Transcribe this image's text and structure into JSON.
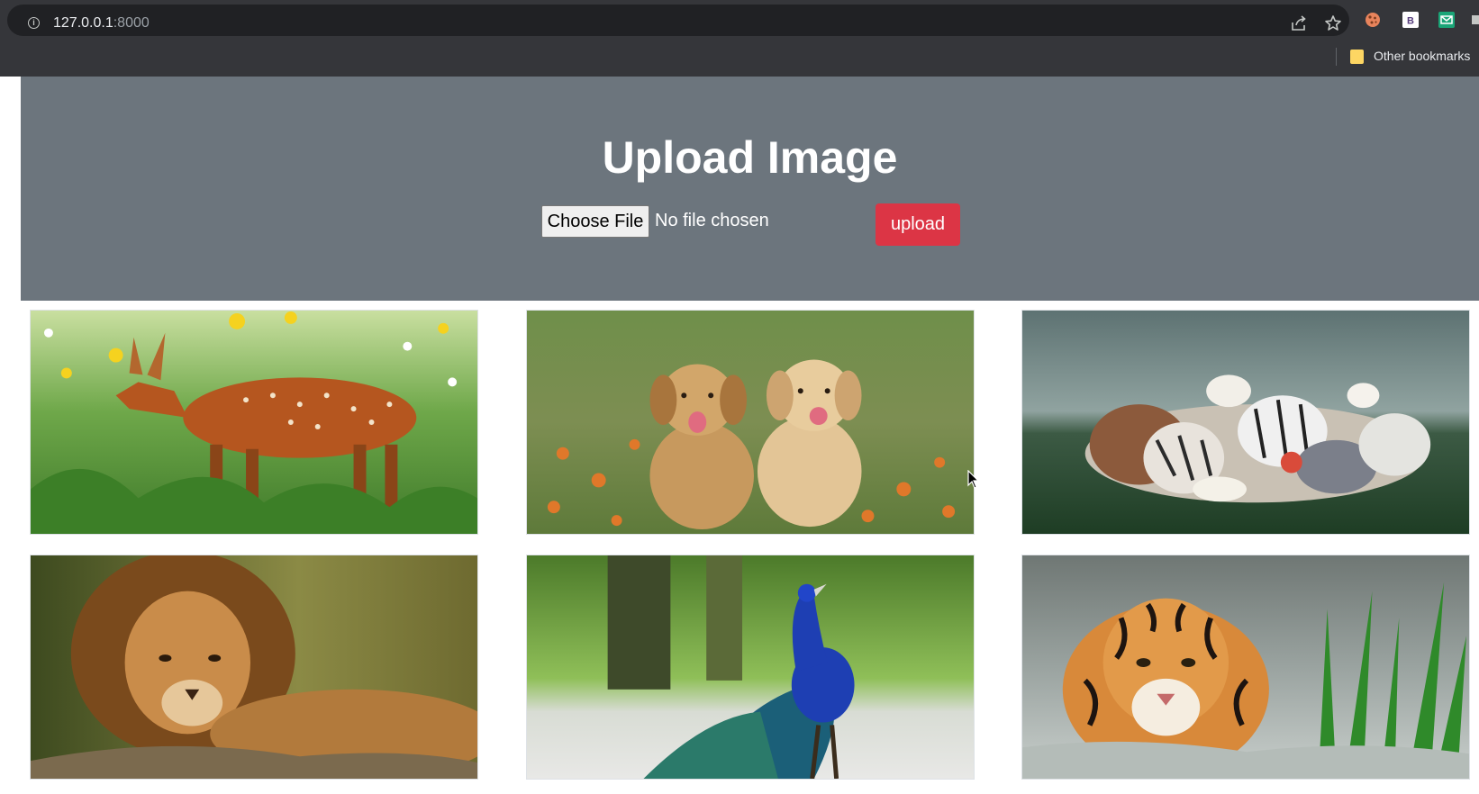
{
  "browser": {
    "url_host": "127.0.0.1",
    "url_port": ":8000",
    "bookmarks_label": "Other bookmarks",
    "extension_b_label": "B"
  },
  "hero": {
    "title": "Upload Image",
    "file_button_label": "Choose File",
    "file_status": "No file chosen",
    "upload_button_label": "upload",
    "background_color": "#6c757d",
    "upload_color": "#dc3545"
  },
  "gallery": {
    "images": [
      {
        "subject": "fawn"
      },
      {
        "subject": "puppies"
      },
      {
        "subject": "animal-group"
      },
      {
        "subject": "lion"
      },
      {
        "subject": "peacock"
      },
      {
        "subject": "tiger"
      }
    ]
  }
}
